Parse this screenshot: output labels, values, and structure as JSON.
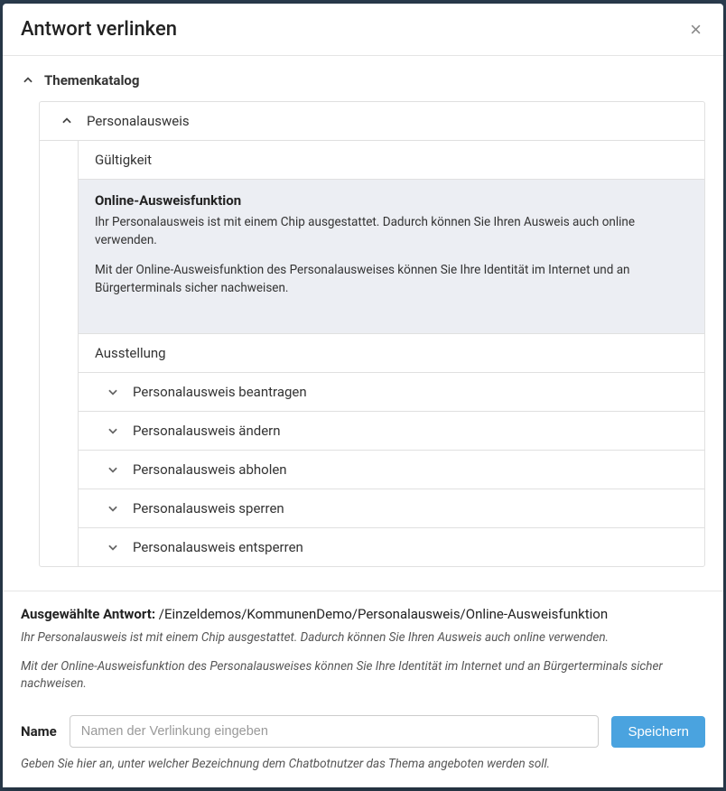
{
  "modal": {
    "title": "Antwort verlinken"
  },
  "tree": {
    "root_label": "Themenkatalog",
    "section": {
      "title": "Personalausweis",
      "items": [
        {
          "label": "Gültigkeit"
        },
        {
          "label": "Online-Ausweisfunktion",
          "desc_p1": "Ihr Personalausweis ist mit einem Chip ausgestattet. Dadurch können Sie Ihren Ausweis auch online verwenden.",
          "desc_p2": "Mit der Online-Ausweisfunktion des Personalausweises können Sie Ihre Identität im Internet und an Bürgerterminals sicher nachweisen."
        },
        {
          "label": "Ausstellung"
        }
      ],
      "sub_items": [
        {
          "label": "Personalausweis beantragen"
        },
        {
          "label": "Personalausweis ändern"
        },
        {
          "label": "Personalausweis abholen"
        },
        {
          "label": "Personalausweis sperren"
        },
        {
          "label": "Personalausweis entsperren"
        }
      ]
    }
  },
  "footer": {
    "selected_label": "Ausgewählte Antwort: ",
    "selected_path": "/Einzeldemos/KommunenDemo/Personalausweis/Online-Ausweisfunktion",
    "preview_p1": "Ihr Personalausweis ist mit einem Chip ausgestattet. Dadurch können Sie Ihren Ausweis auch online verwenden.",
    "preview_p2": "Mit der Online-Ausweisfunktion des Personalausweises können Sie Ihre Identität im Internet und an Bürgerterminals sicher nachweisen.",
    "name_label": "Name",
    "name_placeholder": "Namen der Verlinkung eingeben",
    "save_label": "Speichern",
    "hint": "Geben Sie hier an, unter welcher Bezeichnung dem Chatbotnutzer das Thema angeboten werden soll."
  }
}
